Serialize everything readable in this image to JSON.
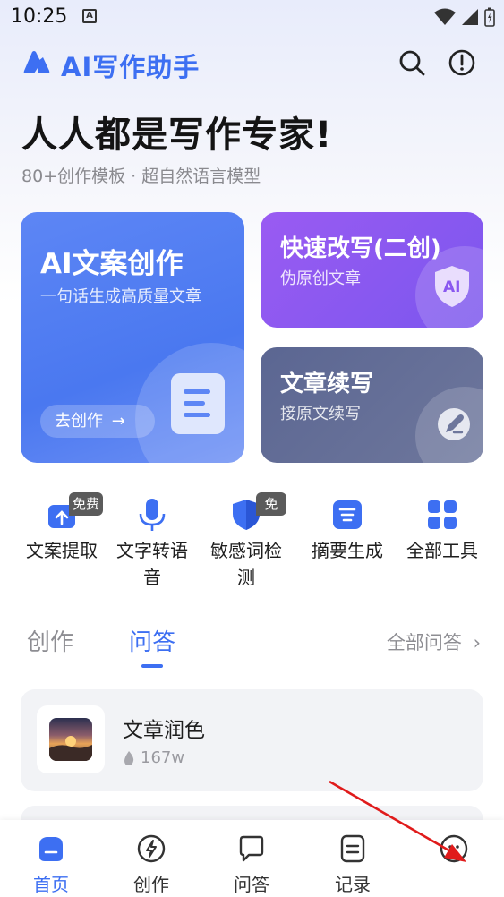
{
  "status_bar": {
    "time": "10:25",
    "notification_glyph": "A"
  },
  "header": {
    "app_title": "AI写作助手",
    "icons": [
      "logo-icon",
      "search-icon",
      "info-icon"
    ]
  },
  "hero": {
    "title": "人人都是写作专家!",
    "subtitle": "80+创作模板 · 超自然语言模型"
  },
  "cards": {
    "main": {
      "title": "AI文案创作",
      "desc": "一句话生成高质量文章",
      "button": "去创作"
    },
    "rewrite": {
      "title": "快速改写(二创)",
      "desc": "伪原创文章",
      "badge_text": "AI"
    },
    "continue": {
      "title": "文章续写",
      "desc": "接原文续写"
    }
  },
  "tools": [
    {
      "label": "文案提取",
      "badge": "免费",
      "icon": "upload-icon"
    },
    {
      "label": "文字转语音",
      "badge": "",
      "icon": "microphone-icon"
    },
    {
      "label": "敏感词检测",
      "badge": "免费",
      "icon": "shield-icon"
    },
    {
      "label": "摘要生成",
      "badge": "",
      "icon": "list-icon"
    },
    {
      "label": "全部工具",
      "badge": "",
      "icon": "grid-icon"
    }
  ],
  "tabs": {
    "create": "创作",
    "qa": "问答",
    "active": "问答",
    "all_link": "全部问答"
  },
  "list": [
    {
      "title": "文章润色",
      "count": "167w"
    }
  ],
  "bottom_nav": [
    {
      "label": "首页",
      "icon": "home-icon",
      "active": true
    },
    {
      "label": "创作",
      "icon": "lightning-icon",
      "active": false
    },
    {
      "label": "问答",
      "icon": "chat-icon",
      "active": false
    },
    {
      "label": "记录",
      "icon": "record-icon",
      "active": false
    },
    {
      "label": "",
      "icon": "profile-icon",
      "active": false
    }
  ],
  "colors": {
    "accent": "#3d6ff2",
    "main_card": "#4a78f0",
    "rewrite_card": "#8a58f0",
    "continue_card": "#626c95",
    "annotation_arrow": "#e01b1b"
  }
}
